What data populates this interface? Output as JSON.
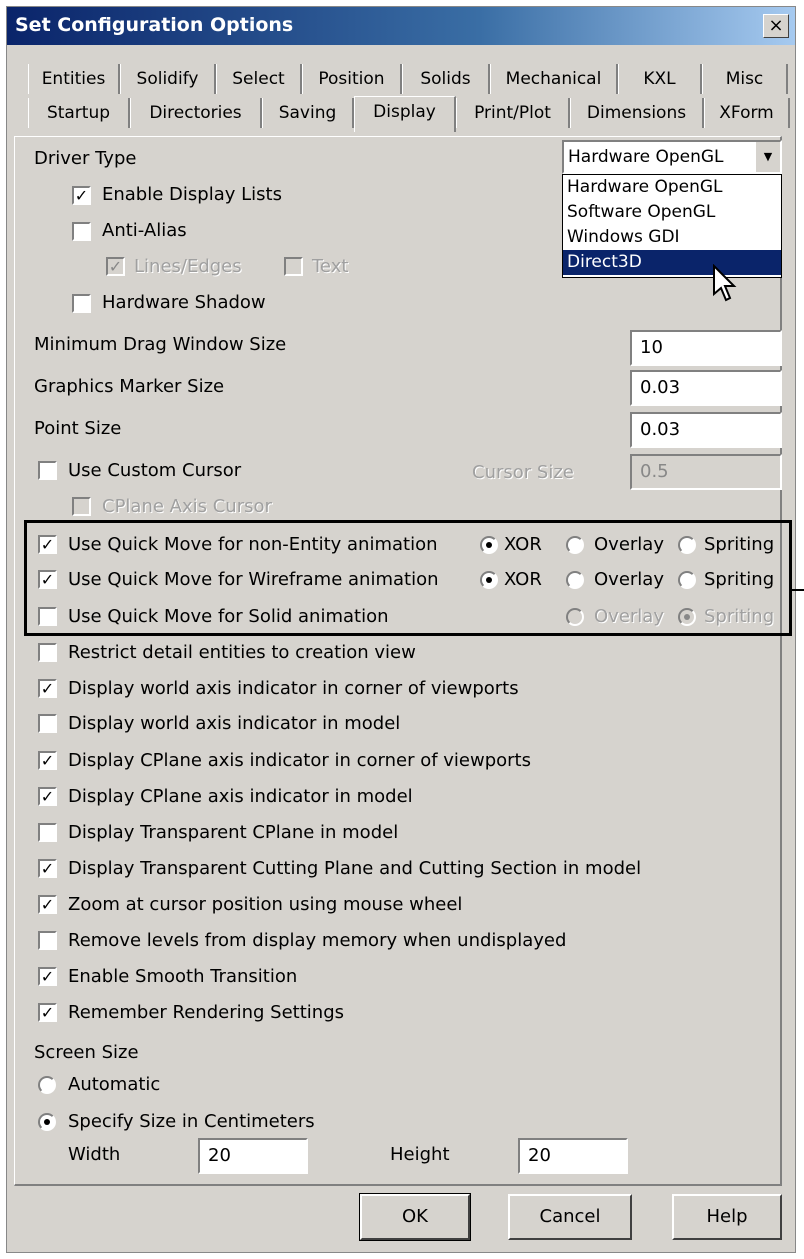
{
  "window": {
    "title": "Set Configuration Options",
    "close": "×"
  },
  "tabs": {
    "row1": [
      "Entities",
      "Solidify",
      "Select",
      "Position",
      "Solids",
      "Mechanical",
      "KXL",
      "Misc"
    ],
    "row2": [
      "Startup",
      "Directories",
      "Saving",
      "Display",
      "Print/Plot",
      "Dimensions",
      "XForm"
    ],
    "active": "Display"
  },
  "driver": {
    "label": "Driver Type",
    "selected": "Hardware OpenGL",
    "options": [
      "Hardware OpenGL",
      "Software OpenGL",
      "Windows GDI",
      "Direct3D"
    ],
    "highlighted": "Direct3D"
  },
  "checks": {
    "display_lists": {
      "label": "Enable Display Lists",
      "mark": "✓"
    },
    "anti_alias": {
      "label": "Anti-Alias",
      "mark": ""
    },
    "lines_edges": {
      "label": "Lines/Edges",
      "mark": "✓"
    },
    "text": {
      "label": "Text",
      "mark": ""
    },
    "hw_shadow": {
      "label": "Hardware Shadow",
      "mark": ""
    }
  },
  "sizes": {
    "min_drag_label": "Minimum Drag Window Size",
    "min_drag_value": "10",
    "marker_label": "Graphics Marker Size",
    "marker_value": "0.03",
    "point_label": "Point Size",
    "point_value": "0.03"
  },
  "cursor": {
    "custom_label": "Use Custom Cursor",
    "custom_mark": "",
    "size_label": "Cursor Size",
    "size_value": "0.5",
    "cplane_label": "CPlane Axis Cursor",
    "cplane_mark": ""
  },
  "quickmove": [
    {
      "label": "Use Quick Move for non-Entity animation",
      "mark": "✓",
      "xor": "XOR",
      "overlay": "Overlay",
      "spriting": "Spriting"
    },
    {
      "label": "Use Quick Move for Wireframe animation",
      "mark": "✓",
      "xor": "XOR",
      "overlay": "Overlay",
      "spriting": "Spriting"
    },
    {
      "label": "Use Quick Move for Solid animation",
      "mark": "",
      "overlay": "Overlay",
      "spriting": "Spriting"
    }
  ],
  "options": [
    {
      "label": "Restrict detail entities to creation view",
      "mark": ""
    },
    {
      "label": "Display world axis indicator in corner of viewports",
      "mark": "✓"
    },
    {
      "label": "Display world axis indicator in model",
      "mark": ""
    },
    {
      "label": "Display CPlane axis indicator in corner of viewports",
      "mark": "✓"
    },
    {
      "label": "Display CPlane axis indicator in model",
      "mark": "✓"
    },
    {
      "label": "Display Transparent CPlane in model",
      "mark": ""
    },
    {
      "label": "Display Transparent Cutting Plane and Cutting Section in model",
      "mark": "✓"
    },
    {
      "label": "Zoom at cursor position using mouse wheel",
      "mark": "✓"
    },
    {
      "label": "Remove levels from display memory when undisplayed",
      "mark": ""
    },
    {
      "label": "Enable Smooth Transition",
      "mark": "✓"
    },
    {
      "label": "Remember Rendering Settings",
      "mark": "✓"
    }
  ],
  "screen": {
    "label": "Screen Size",
    "automatic": "Automatic",
    "specify": "Specify Size in Centimeters",
    "width_label": "Width",
    "width_value": "20",
    "height_label": "Height",
    "height_value": "20"
  },
  "buttons": {
    "ok": "OK",
    "cancel": "Cancel",
    "help": "Help"
  }
}
